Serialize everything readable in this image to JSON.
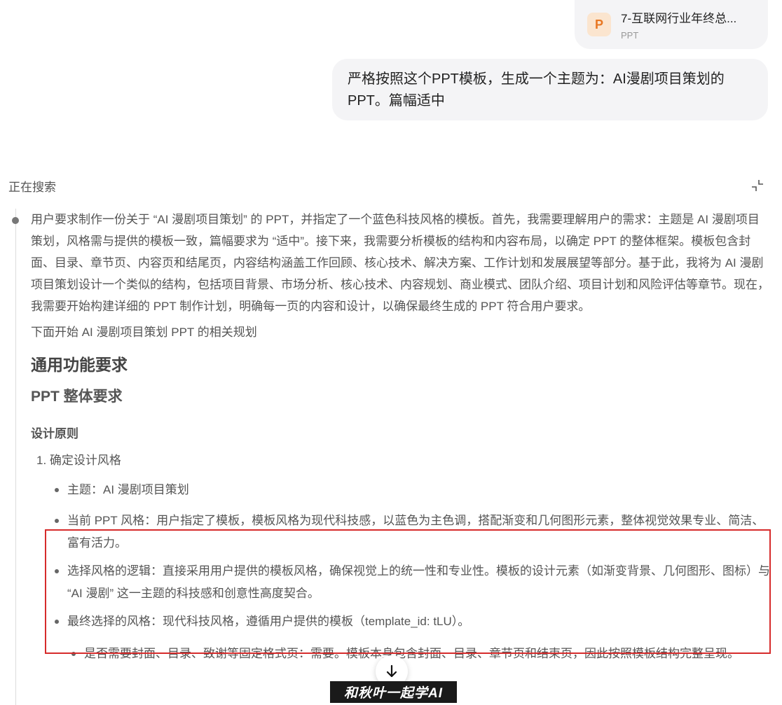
{
  "attachment": {
    "name": "7-互联网行业年终总...",
    "type": "PPT",
    "icon_letter": "P",
    "icon": "ppt-file-icon"
  },
  "user_message": "严格按照这个PPT模板，生成一个主题为：AI漫剧项目策划的PPT。篇幅适中",
  "search": {
    "label": "正在搜索",
    "collapse_icon": "collapse-icon"
  },
  "thinking": {
    "paragraph": "用户要求制作一份关于 “AI 漫剧项目策划” 的 PPT，并指定了一个蓝色科技风格的模板。首先，我需要理解用户的需求：主题是 AI 漫剧项目策划，风格需与提供的模板一致，篇幅要求为 “适中”。接下来，我需要分析模板的结构和内容布局，以确定 PPT 的整体框架。模板包含封面、目录、章节页、内容页和结尾页，内容结构涵盖工作回顾、核心技术、解决方案、工作计划和发展展望等部分。基于此，我将为 AI 漫剧项目策划设计一个类似的结构，包括项目背景、市场分析、核心技术、内容规划、商业模式、团队介绍、项目计划和风险评估等章节。现在，我需要开始构建详细的 PPT 制作计划，明确每一页的内容和设计，以确保最终生成的 PPT 符合用户要求。",
    "plan_intro": "下面开始 AI 漫剧项目策划 PPT 的相关规划",
    "heading_main": "通用功能要求",
    "heading_sub": "PPT 整体要求",
    "heading_small": "设计原则",
    "ordered_item": "1. 确定设计风格",
    "bullets": [
      "主题：AI 漫剧项目策划",
      "当前 PPT 风格：用户指定了模板，模板风格为现代科技感，以蓝色为主色调，搭配渐变和几何图形元素，整体视觉效果专业、简洁、富有活力。",
      "选择风格的逻辑：直接采用用户提供的模板风格，确保视觉上的统一性和专业性。模板的设计元素（如渐变背景、几何图形、图标）与 “AI 漫剧” 这一主题的科技感和创意性高度契合。",
      "最终选择的风格：现代科技风格，遵循用户提供的模板（template_id: tLU）。"
    ],
    "sub_bullet": "是否需要封面、目录、致谢等固定格式页：需要。模板本身包含封面、目录、章节页和结束页，因此按照模板结构完整呈现。"
  },
  "scroll_button_icon": "arrow-down-icon",
  "watermark": "和秋叶一起学AI",
  "colors": {
    "bubble_bg": "#f4f4f6",
    "highlight_border": "#d62b2b",
    "ppt_icon": "#e87722"
  }
}
